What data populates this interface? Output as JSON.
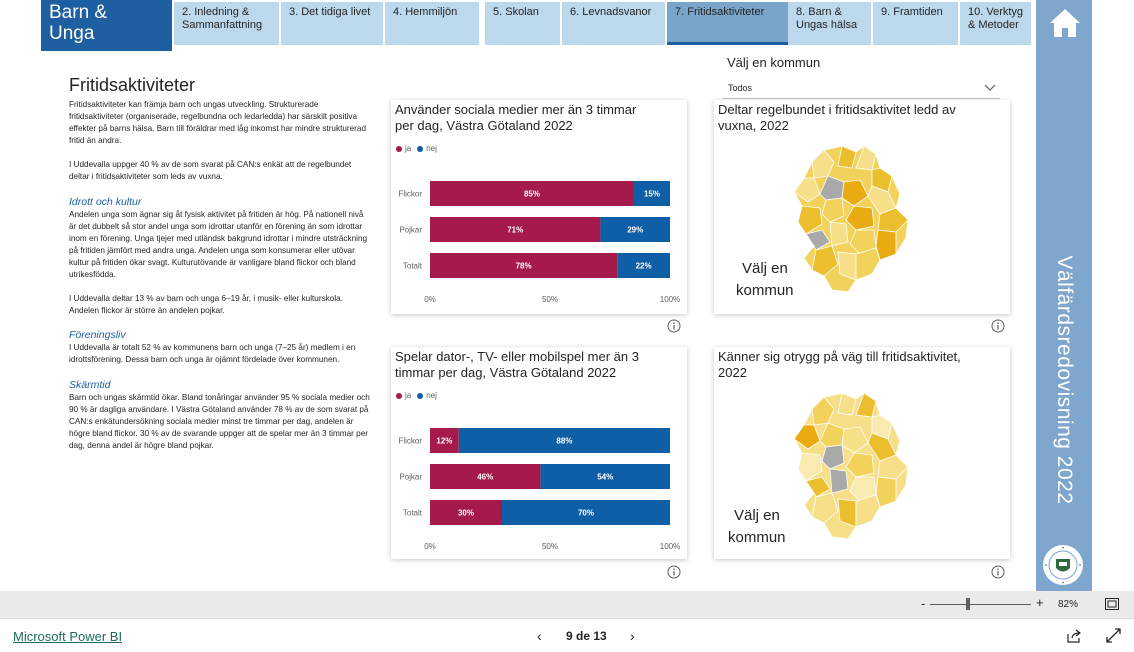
{
  "brand": {
    "line1": "Barn &",
    "line2": "Unga"
  },
  "tabs": [
    {
      "line1": "2. Inledning &",
      "line2": "Sammanfattning"
    },
    {
      "line1": "3. Det tidiga livet",
      "line2": ""
    },
    {
      "line1": "4. Hemmiljön",
      "line2": ""
    },
    {
      "line1": "5. Skolan",
      "line2": ""
    },
    {
      "line1": "6. Levnadsvanor",
      "line2": ""
    },
    {
      "line1": "7. Fritidsaktiviteter",
      "line2": ""
    },
    {
      "line1": "8. Barn &",
      "line2": "Ungas hälsa"
    },
    {
      "line1": "9. Framtiden",
      "line2": ""
    },
    {
      "line1": "10. Verktyg",
      "line2": "& Metoder"
    }
  ],
  "active_tab_index": 5,
  "side_title": "Välfärdsredovisning 2022",
  "page_title": "Fritidsaktiviteter",
  "text": {
    "p1": "Fritidsaktiviteter kan främja barn och ungas utveckling. Strukturerade fritidsaktiviteter (organiserade, regelbundna och ledarledda) har särskilt positiva effekter på barns hälsa. Barn till föräldrar med låg inkomst har mindre strukturerad fritid än andra.",
    "p2": "I Uddevalla uppger 40 % av de som svarat på CAN:s enkät att de regelbundet deltar i fritidsaktiviteter som leds av vuxna.",
    "h1": "Idrott och kultur",
    "p3": "Andelen unga som ägnar sig åt fysisk aktivitet på fritiden är hög. På nationell nivå är det dubbelt så stor andel unga som idrottar utanför en förening än som idrottar inom en förening. Unga tjejer med utländsk bakgrund idrottar i mindre utsträckning på fritiden jämfört med andra unga. Andelen unga som konsumerar eller utövar kultur på fritiden ökar svagt. Kulturutövande är vanligare bland flickor och bland utrikesfödda.",
    "p4": "I Uddevalla deltar 13 % av barn och unga 6–19 år, i musik- eller kulturskola. Andelen flickor är större än andelen pojkar.",
    "h2": "Föreningsliv",
    "p5": "I Uddevalla är totalt 52 % av kommunens barn och unga (7–25 år) medlem i en idrottsförening. Dessa barn och unga är ojämnt fördelade över kommunen.",
    "h3": "Skärmtid",
    "p6": "Barn och ungas skärmtid ökar. Bland tonåringar använder 95 % sociala medier och 90 % är dagliga användare. I Västra Götaland använder 78 % av de som svarat på CAN:s enkätundersökning sociala medier minst tre timmar per dag, andelen är högre bland flickor. 30 % av de svarande uppger att de spelar mer än 3 timmar per dag, denna andel är högre bland pojkar."
  },
  "kommun": {
    "label": "Välj en kommun",
    "selected": "Todos"
  },
  "map_cards": [
    {
      "title_l1": "Deltar regelbundet i fritidsaktivitet ledd av",
      "title_l2": "vuxna, 2022",
      "overlay_l1": "Välj en",
      "overlay_l2": "kommun"
    },
    {
      "title_l1": "Känner sig otrygg på väg till fritidsaktivitet,",
      "title_l2": "2022",
      "overlay_l1": "Välj en",
      "overlay_l2": "kommun"
    }
  ],
  "colors": {
    "ja": "#a6194b",
    "nej": "#0f5fa6",
    "brand": "#1d5fa0",
    "band": "#7fa6cd",
    "tab": "#bcd8ed",
    "tab_active": "#79a5cb"
  },
  "chart_data": [
    {
      "type": "bar",
      "orientation": "horizontal",
      "stacked": "100%",
      "title": "Använder sociala medier mer än 3 timmar per dag, Västra Götaland 2022",
      "title_l1": "Använder sociala medier mer än 3 timmar",
      "title_l2": "per dag, Västra Götaland 2022",
      "legend": [
        "ja",
        "nej"
      ],
      "categories": [
        "Flickor",
        "Pojkar",
        "Totalt"
      ],
      "series": [
        {
          "name": "ja",
          "values": [
            85,
            71,
            78
          ]
        },
        {
          "name": "nej",
          "values": [
            15,
            29,
            22
          ]
        }
      ],
      "xticks": [
        "0%",
        "50%",
        "100%"
      ],
      "xlim": [
        0,
        100
      ]
    },
    {
      "type": "bar",
      "orientation": "horizontal",
      "stacked": "100%",
      "title": "Spelar dator-, TV- eller mobilspel mer än 3 timmar per dag, Västra Götaland 2022",
      "title_l1": "Spelar dator-, TV- eller mobilspel mer än 3",
      "title_l2": "timmar per dag, Västra Götaland 2022",
      "legend": [
        "ja",
        "nej"
      ],
      "categories": [
        "Flickor",
        "Pojkar",
        "Totalt"
      ],
      "series": [
        {
          "name": "ja",
          "values": [
            12,
            46,
            30
          ]
        },
        {
          "name": "nej",
          "values": [
            88,
            54,
            70
          ]
        }
      ],
      "xticks": [
        "0%",
        "50%",
        "100%"
      ],
      "xlim": [
        0,
        100
      ]
    }
  ],
  "footer": {
    "zoom_minus": "-",
    "zoom_plus": "+",
    "zoom": "82%",
    "zoom_level": 0.38,
    "link": "Microsoft Power BI",
    "prev": "‹",
    "next": "›",
    "page": "9 de 13"
  }
}
